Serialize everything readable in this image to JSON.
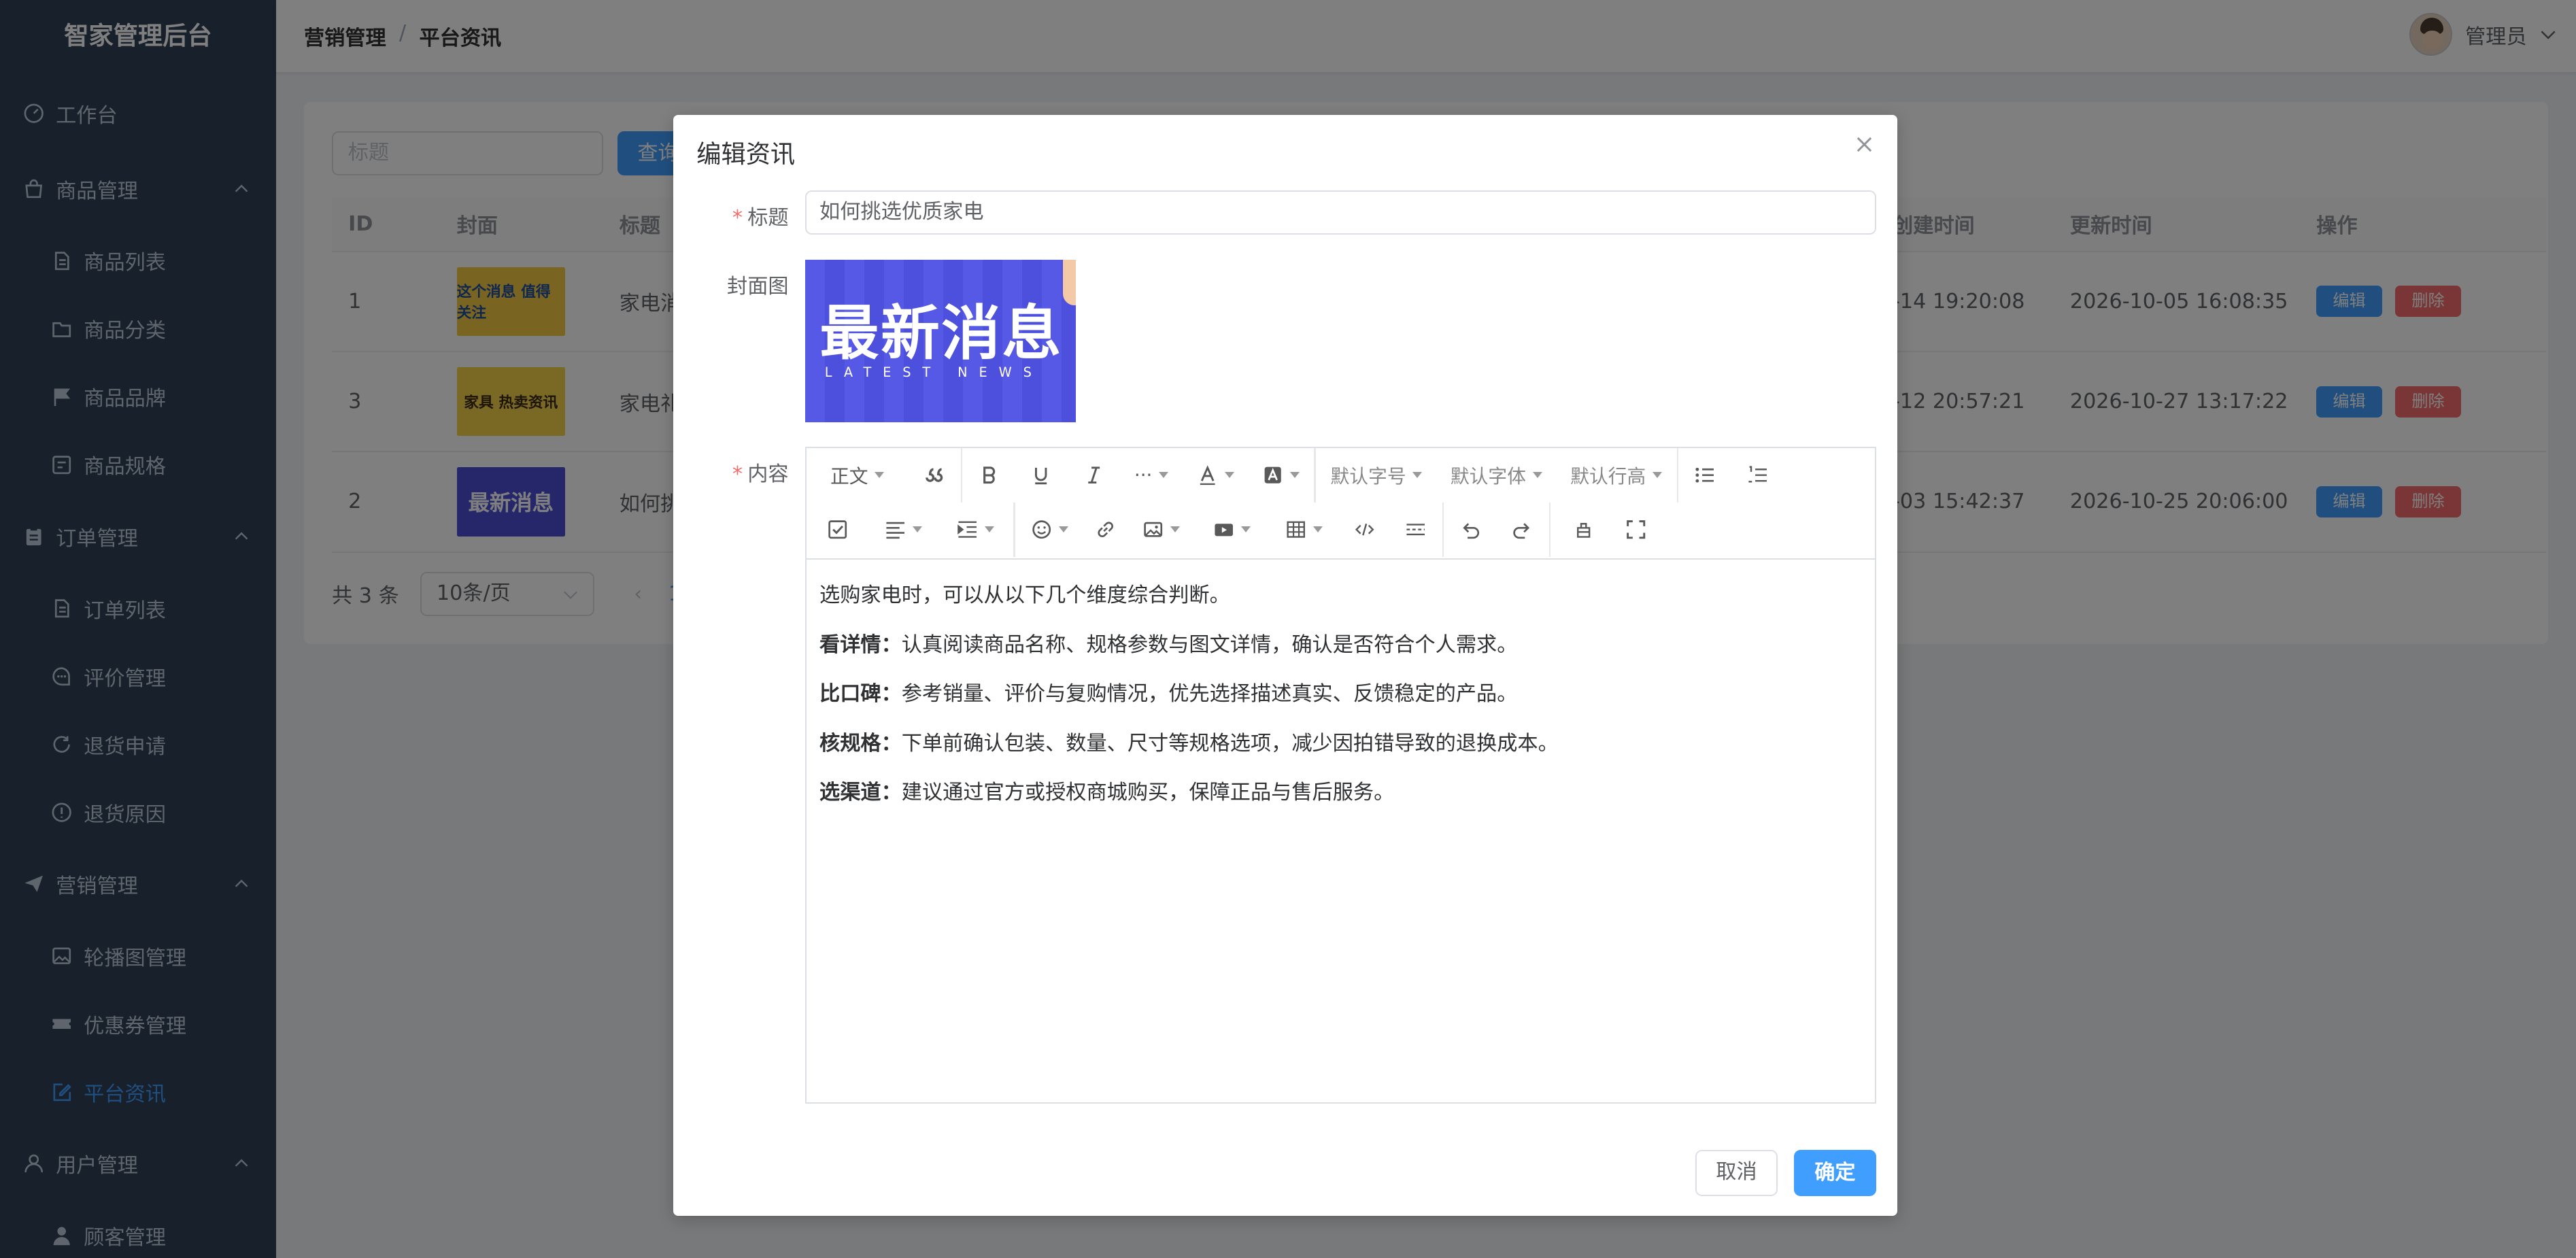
{
  "sidebar": {
    "logo": "智家管理后台",
    "items": [
      {
        "label": "工作台",
        "type": "top",
        "icon": "dashboard-icon"
      },
      {
        "label": "商品管理",
        "type": "top",
        "icon": "bag-icon"
      },
      {
        "label": "商品列表",
        "type": "sub",
        "icon": "document-icon"
      },
      {
        "label": "商品分类",
        "type": "sub",
        "icon": "folder-icon"
      },
      {
        "label": "商品品牌",
        "type": "sub",
        "icon": "flag-icon"
      },
      {
        "label": "商品规格",
        "type": "sub",
        "icon": "spec-icon"
      },
      {
        "label": "订单管理",
        "type": "top",
        "icon": "clipboard-icon"
      },
      {
        "label": "订单列表",
        "type": "sub",
        "icon": "document-icon"
      },
      {
        "label": "评价管理",
        "type": "sub",
        "icon": "chat-icon"
      },
      {
        "label": "退货申请",
        "type": "sub",
        "icon": "refresh-icon"
      },
      {
        "label": "退货原因",
        "type": "sub",
        "icon": "info-circle-icon"
      },
      {
        "label": "营销管理",
        "type": "top",
        "icon": "send-icon"
      },
      {
        "label": "轮播图管理",
        "type": "sub",
        "icon": "picture-icon"
      },
      {
        "label": "优惠券管理",
        "type": "sub",
        "icon": "ticket-icon"
      },
      {
        "label": "平台资讯",
        "type": "sub",
        "icon": "edit-note-icon",
        "active": true
      },
      {
        "label": "用户管理",
        "type": "top",
        "icon": "user-icon"
      },
      {
        "label": "顾客管理",
        "type": "sub",
        "icon": "person-icon"
      }
    ]
  },
  "header": {
    "breadcrumb": [
      "营销管理",
      "平台资讯"
    ],
    "separator": "/",
    "user_name": "管理员"
  },
  "list": {
    "search_placeholder": "标题",
    "search_button": "查询",
    "columns": [
      "ID",
      "封面",
      "标题",
      "创建时间",
      "更新时间",
      "操作"
    ],
    "rows": [
      {
        "id": "1",
        "cover_text": "这个消息 值得关注",
        "title": "家电消",
        "created": "-14 19:20:08",
        "updated": "2026-10-05 16:08:35"
      },
      {
        "id": "3",
        "cover_text": "家具 热卖资讯",
        "title": "家电礼",
        "created": "-12 20:57:21",
        "updated": "2026-10-27 13:17:22"
      },
      {
        "id": "2",
        "cover_text": "最新消息",
        "title": "如何挑",
        "created": "-03 15:42:37",
        "updated": "2026-10-25 20:06:00"
      }
    ],
    "edit_label": "编辑",
    "delete_label": "删除",
    "total": "共 3 条",
    "page_size": "10条/页",
    "prev": "‹",
    "page": "1"
  },
  "dialog": {
    "title": "编辑资讯",
    "title_label": "标题",
    "title_value": "如何挑选优质家电",
    "cover_label": "封面图",
    "cover_big": "最新消息",
    "cover_small": "LATEST NEWS",
    "content_label": "内容",
    "toolbar": {
      "heading": "正文",
      "font_size": "默认字号",
      "font_family": "默认字体",
      "line_height": "默认行高",
      "more": "···"
    },
    "content": {
      "intro": "选购家电时，可以从以下几个维度综合判断。",
      "p1_bold": "看详情：",
      "p1_text": "认真阅读商品名称、规格参数与图文详情，确认是否符合个人需求。",
      "p2_bold": "比口碑：",
      "p2_text": "参考销量、评价与复购情况，优先选择描述真实、反馈稳定的产品。",
      "p3_bold": "核规格：",
      "p3_text": "下单前确认包装、数量、尺寸等规格选项，减少因拍错导致的退换成本。",
      "p4_bold": "选渠道：",
      "p4_text": "建议通过官方或授权商城购买，保障正品与售后服务。"
    },
    "cancel": "取消",
    "confirm": "确定"
  },
  "colors": {
    "sidebar_bg": "#304156",
    "accent": "#409eff",
    "danger": "#f56c6c"
  }
}
